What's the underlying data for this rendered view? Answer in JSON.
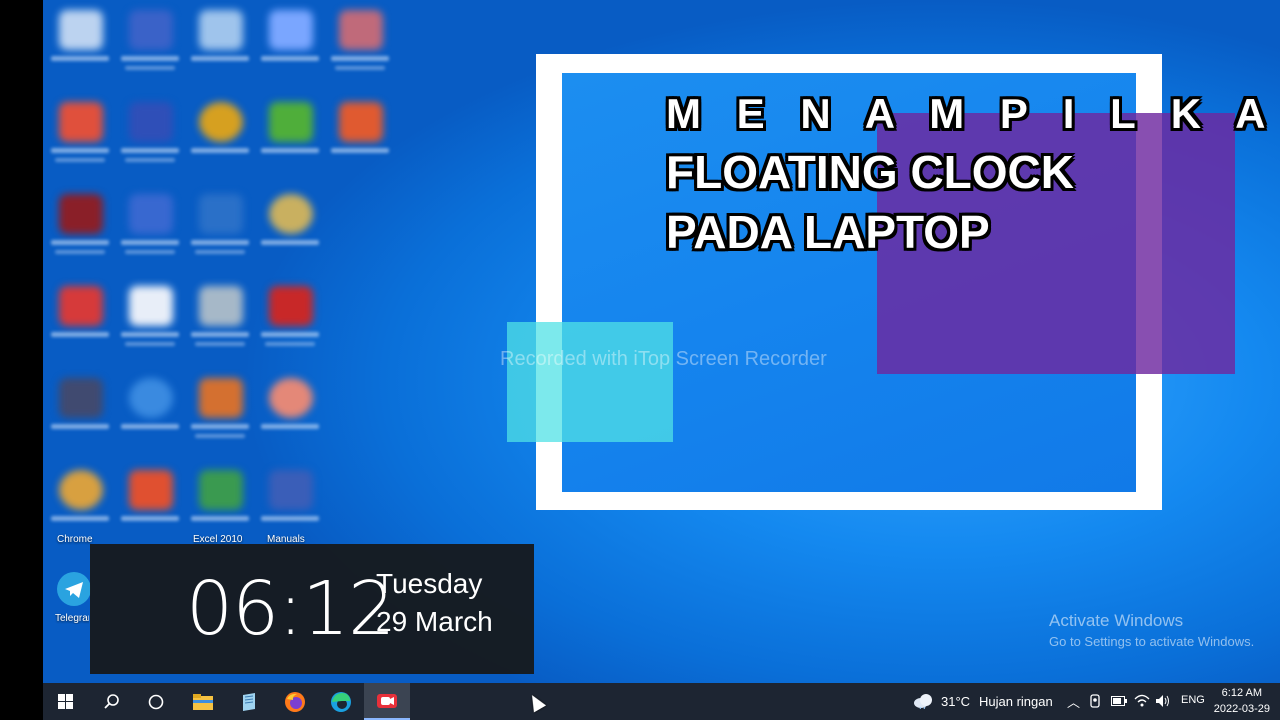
{
  "overlay": {
    "headline_line1": "M E N A M P I L K A N",
    "headline_line2": "FLOATING CLOCK",
    "headline_line3": "PADA LAPTOP",
    "watermark": "Recorded with iTop Screen Recorder",
    "frame_color": "#ffffff",
    "purple_color": "#6e28a0",
    "cyan_color": "#50e1e6"
  },
  "desktop": {
    "visible_labels": [
      "Chrome",
      "Excel 2010",
      "Manuals",
      "Telegram"
    ],
    "activate_title": "Activate Windows",
    "activate_sub": "Go to Settings to activate Windows."
  },
  "floating_clock": {
    "time": "06:12",
    "day": "Tuesday",
    "date": "29 March"
  },
  "taskbar": {
    "apps": [
      {
        "name": "start-icon"
      },
      {
        "name": "search-icon"
      },
      {
        "name": "task-view-icon"
      },
      {
        "name": "file-explorer-icon"
      },
      {
        "name": "notepad-icon"
      },
      {
        "name": "firefox-icon"
      },
      {
        "name": "edge-icon"
      },
      {
        "name": "screen-recorder-icon"
      }
    ],
    "weather_temp": "31°C",
    "weather_text": "Hujan ringan",
    "language": "ENG",
    "time": "6:12 AM",
    "date": "2022-03-29"
  }
}
